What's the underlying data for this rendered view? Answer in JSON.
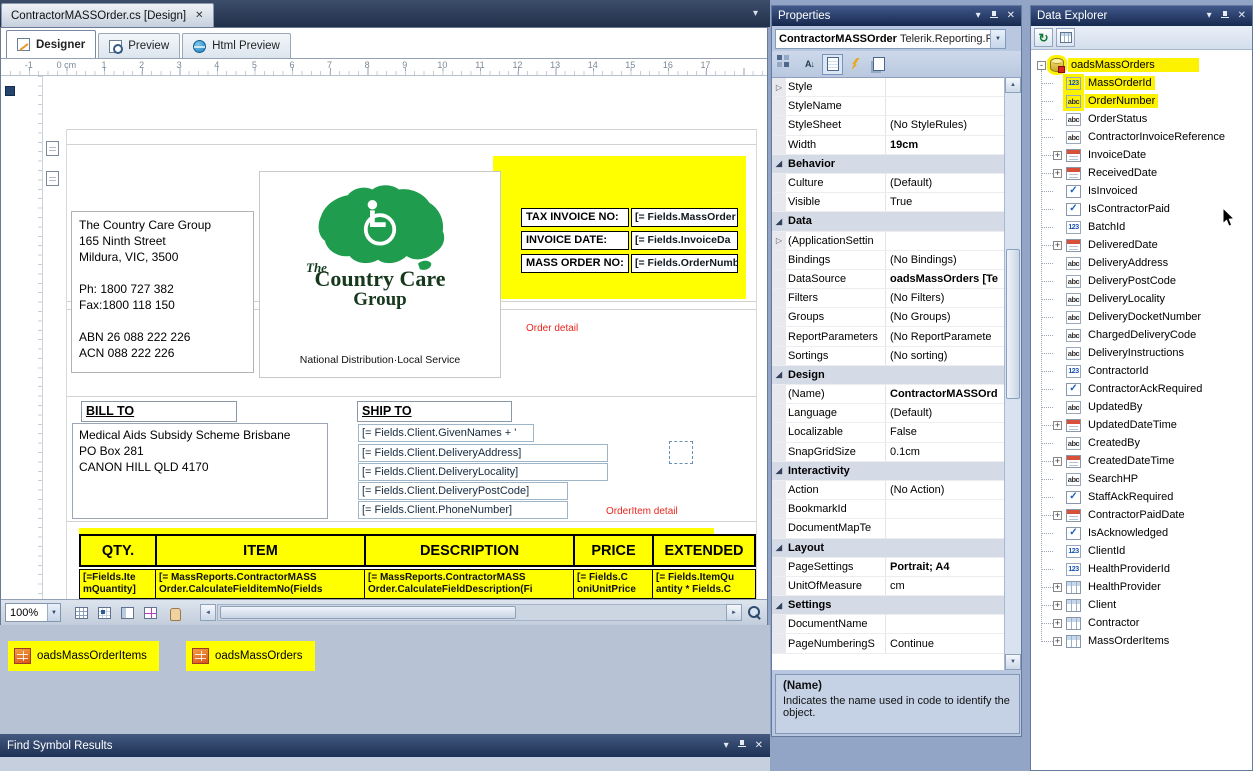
{
  "icons": {
    "chevron_down": "▾",
    "close": "✕",
    "dropdown": "▼",
    "scroll_up": "▲",
    "scroll_down": "▼",
    "scroll_left": "◄",
    "scroll_right": "►"
  },
  "colors": {
    "highlight_yellow": "#FFFF00",
    "header_blue_top": "#41588A",
    "header_blue_bottom": "#16294E",
    "logo_green": "#1F9C4D",
    "detail_red": "#E8271C"
  },
  "doc_tab": {
    "title": "ContractorMASSOrder.cs [Design]"
  },
  "designer": {
    "tabs": [
      {
        "label": "Designer",
        "icon": "designer-icon",
        "state": "active"
      },
      {
        "label": "Preview",
        "icon": "preview-icon",
        "state": ""
      },
      {
        "label": "Html Preview",
        "icon": "html-preview-icon",
        "state": ""
      }
    ],
    "ruler_labels": [
      "-1",
      "0 cm",
      "1",
      "2",
      "3",
      "4",
      "5",
      "6",
      "7",
      "8",
      "9",
      "10",
      "11",
      "12",
      "13",
      "14",
      "15",
      "16",
      "17"
    ],
    "zoom_level": "100%",
    "bottom_toolbar_icons": [
      "grid-icon",
      "snap-grid-icon",
      "layout-grid-icon",
      "snapline-icon",
      "pan-icon"
    ],
    "report": {
      "company_address": "The Country Care Group\n165 Ninth Street\nMildura, VIC, 3500\n\nPh: 1800 727 382\nFax:1800 118 150\n\nABN 26 088 222 226\nACN 088 222 226",
      "logo": {
        "the": "The",
        "name_line1": "Country Care",
        "name_line2": "Group",
        "tagline": "National Distribution·Local Service"
      },
      "invoice_fields": [
        {
          "label": "TAX INVOICE NO:",
          "value": "[= Fields.MassOrder"
        },
        {
          "label": "INVOICE DATE:",
          "value": "[= Fields.InvoiceDa"
        },
        {
          "label": "MASS ORDER NO:",
          "value": "[= Fields.OrderNumb"
        }
      ],
      "order_detail_label": "Order detail",
      "bill_to_header": "BILL TO",
      "bill_to_text": "Medical Aids Subsidy Scheme Brisbane\nPO Box 281\nCANON HILL QLD 4170",
      "ship_to_header": "SHIP TO",
      "ship_fields": [
        "[= Fields.Client.GivenNames + '",
        "[= Fields.Client.DeliveryAddress]",
        "[= Fields.Client.DeliveryLocality]",
        "[= Fields.Client.DeliveryPostCode]",
        "[= Fields.Client.PhoneNumber]"
      ],
      "orderitem_detail_label": "OrderItem detail",
      "table_headers": [
        "QTY.",
        "ITEM",
        "DESCRIPTION",
        "PRICE",
        "EXTENDED"
      ],
      "table_row": [
        "[=Fields.Ite\nmQuantity]",
        "[= MassReports.ContractorMASS\nOrder.CalculateFielditemNo(Fields",
        "[= MassReports.ContractorMASS\nOrder.CalculateFieldDescription(Fi",
        "[= Fields.C\noniUnitPrice",
        "[= Fields.ItemQu\nantity * Fields.C"
      ]
    },
    "components": [
      {
        "label": "oadsMassOrderItems",
        "icon": "datasource-icon"
      },
      {
        "label": "oadsMassOrders",
        "icon": "datasource-icon"
      }
    ]
  },
  "properties_panel": {
    "title": "Properties",
    "object_name": "ContractorMASSOrder",
    "object_type": "Telerik.Reporting.R",
    "toolbar_icons": [
      "categorized-icon",
      "alphabetical-icon",
      "properties-icon",
      "events-icon",
      "property-pages-icon"
    ],
    "rows": [
      {
        "kind": "prop",
        "expander": "▷",
        "label": "Style",
        "value": "",
        "emphasis": ""
      },
      {
        "kind": "prop",
        "expander": "",
        "label": "StyleName",
        "value": "",
        "emphasis": ""
      },
      {
        "kind": "prop",
        "expander": "",
        "label": "StyleSheet",
        "value": "(No StyleRules)",
        "emphasis": ""
      },
      {
        "kind": "prop",
        "expander": "",
        "label": "Width",
        "value": "19cm",
        "emphasis": "bold"
      },
      {
        "kind": "category",
        "expander": "◢",
        "label": "Behavior",
        "value": "",
        "emphasis": ""
      },
      {
        "kind": "prop",
        "expander": "",
        "label": "Culture",
        "value": "(Default)",
        "emphasis": ""
      },
      {
        "kind": "prop",
        "expander": "",
        "label": "Visible",
        "value": "True",
        "emphasis": ""
      },
      {
        "kind": "category",
        "expander": "◢",
        "label": "Data",
        "value": "",
        "emphasis": ""
      },
      {
        "kind": "prop",
        "expander": "▷",
        "label": "(ApplicationSettin",
        "value": "",
        "emphasis": ""
      },
      {
        "kind": "prop",
        "expander": "",
        "label": "Bindings",
        "value": "(No Bindings)",
        "emphasis": ""
      },
      {
        "kind": "prop",
        "expander": "",
        "label": "DataSource",
        "value": "oadsMassOrders [Te",
        "emphasis": "bold"
      },
      {
        "kind": "prop",
        "expander": "",
        "label": "Filters",
        "value": "(No Filters)",
        "emphasis": ""
      },
      {
        "kind": "prop",
        "expander": "",
        "label": "Groups",
        "value": "(No Groups)",
        "emphasis": ""
      },
      {
        "kind": "prop",
        "expander": "",
        "label": "ReportParameters",
        "value": "(No ReportParamete",
        "emphasis": ""
      },
      {
        "kind": "prop",
        "expander": "",
        "label": "Sortings",
        "value": "(No sorting)",
        "emphasis": ""
      },
      {
        "kind": "category",
        "expander": "◢",
        "label": "Design",
        "value": "",
        "emphasis": ""
      },
      {
        "kind": "prop",
        "expander": "",
        "label": "(Name)",
        "value": "ContractorMASSOrd",
        "emphasis": "bold"
      },
      {
        "kind": "prop",
        "expander": "",
        "label": "Language",
        "value": "(Default)",
        "emphasis": ""
      },
      {
        "kind": "prop",
        "expander": "",
        "label": "Localizable",
        "value": "False",
        "emphasis": ""
      },
      {
        "kind": "prop",
        "expander": "",
        "label": "SnapGridSize",
        "value": "0.1cm",
        "emphasis": ""
      },
      {
        "kind": "category",
        "expander": "◢",
        "label": "Interactivity",
        "value": "",
        "emphasis": ""
      },
      {
        "kind": "prop",
        "expander": "",
        "label": "Action",
        "value": "(No Action)",
        "emphasis": ""
      },
      {
        "kind": "prop",
        "expander": "",
        "label": "BookmarkId",
        "value": "",
        "emphasis": ""
      },
      {
        "kind": "prop",
        "expander": "",
        "label": "DocumentMapTe",
        "value": "",
        "emphasis": ""
      },
      {
        "kind": "category",
        "expander": "◢",
        "label": "Layout",
        "value": "",
        "emphasis": ""
      },
      {
        "kind": "prop",
        "expander": "",
        "label": "PageSettings",
        "value": "Portrait; A4",
        "emphasis": "bold"
      },
      {
        "kind": "prop",
        "expander": "",
        "label": "UnitOfMeasure",
        "value": "cm",
        "emphasis": ""
      },
      {
        "kind": "category",
        "expander": "◢",
        "label": "Settings",
        "value": "",
        "emphasis": ""
      },
      {
        "kind": "prop",
        "expander": "",
        "label": "DocumentName",
        "value": "",
        "emphasis": ""
      },
      {
        "kind": "prop",
        "expander": "",
        "label": "PageNumberingS",
        "value": "Continue",
        "emphasis": ""
      }
    ],
    "description_title": "(Name)",
    "description_text": "Indicates the name used in code to identify the object."
  },
  "data_explorer": {
    "title": "Data Explorer",
    "toolbar_icons": [
      "refresh-icon",
      "table-grid-icon"
    ],
    "tree": [
      {
        "cls": "root hl",
        "expander": "-",
        "icon": "database-icon",
        "label": "oadsMassOrders"
      },
      {
        "cls": "child hl",
        "expander": "",
        "icon": "number-icon",
        "label": "MassOrderId"
      },
      {
        "cls": "child hl",
        "expander": "",
        "icon": "string-icon",
        "label": "OrderNumber"
      },
      {
        "cls": "child",
        "expander": "",
        "icon": "string-icon",
        "label": "OrderStatus"
      },
      {
        "cls": "child",
        "expander": "",
        "icon": "string-icon",
        "label": "ContractorInvoiceReference"
      },
      {
        "cls": "child",
        "expander": "+",
        "icon": "date-icon",
        "label": "InvoiceDate"
      },
      {
        "cls": "child",
        "expander": "+",
        "icon": "date-icon",
        "label": "ReceivedDate"
      },
      {
        "cls": "child",
        "expander": "",
        "icon": "bool-icon",
        "label": "IsInvoiced"
      },
      {
        "cls": "child",
        "expander": "",
        "icon": "bool-icon",
        "label": "IsContractorPaid"
      },
      {
        "cls": "child",
        "expander": "",
        "icon": "number-icon",
        "label": "BatchId"
      },
      {
        "cls": "child",
        "expander": "+",
        "icon": "date-icon",
        "label": "DeliveredDate"
      },
      {
        "cls": "child",
        "expander": "",
        "icon": "string-icon",
        "label": "DeliveryAddress"
      },
      {
        "cls": "child",
        "expander": "",
        "icon": "string-icon",
        "label": "DeliveryPostCode"
      },
      {
        "cls": "child",
        "expander": "",
        "icon": "string-icon",
        "label": "DeliveryLocality"
      },
      {
        "cls": "child",
        "expander": "",
        "icon": "string-icon",
        "label": "DeliveryDocketNumber"
      },
      {
        "cls": "child",
        "expander": "",
        "icon": "string-icon",
        "label": "ChargedDeliveryCode"
      },
      {
        "cls": "child",
        "expander": "",
        "icon": "string-icon",
        "label": "DeliveryInstructions"
      },
      {
        "cls": "child",
        "expander": "",
        "icon": "number-icon",
        "label": "ContractorId"
      },
      {
        "cls": "child",
        "expander": "",
        "icon": "bool-icon",
        "label": "ContractorAckRequired"
      },
      {
        "cls": "child",
        "expander": "",
        "icon": "string-icon",
        "label": "UpdatedBy"
      },
      {
        "cls": "child",
        "expander": "+",
        "icon": "date-icon",
        "label": "UpdatedDateTime"
      },
      {
        "cls": "child",
        "expander": "",
        "icon": "string-icon",
        "label": "CreatedBy"
      },
      {
        "cls": "child",
        "expander": "+",
        "icon": "date-icon",
        "label": "CreatedDateTime"
      },
      {
        "cls": "child",
        "expander": "",
        "icon": "string-icon",
        "label": "SearchHP"
      },
      {
        "cls": "child",
        "expander": "",
        "icon": "bool-icon",
        "label": "StaffAckRequired"
      },
      {
        "cls": "child",
        "expander": "+",
        "icon": "date-icon",
        "label": "ContractorPaidDate"
      },
      {
        "cls": "child",
        "expander": "",
        "icon": "bool-icon",
        "label": "IsAcknowledged"
      },
      {
        "cls": "child",
        "expander": "",
        "icon": "number-icon",
        "label": "ClientId"
      },
      {
        "cls": "child",
        "expander": "",
        "icon": "number-icon",
        "label": "HealthProviderId"
      },
      {
        "cls": "child",
        "expander": "+",
        "icon": "table-icon",
        "label": "HealthProvider"
      },
      {
        "cls": "child",
        "expander": "+",
        "icon": "table-icon",
        "label": "Client"
      },
      {
        "cls": "child",
        "expander": "+",
        "icon": "table-icon",
        "label": "Contractor"
      },
      {
        "cls": "child",
        "expander": "+",
        "icon": "table-icon",
        "label": "MassOrderItems"
      }
    ]
  },
  "find_symbol_bar": {
    "title": "Find Symbol Results"
  }
}
